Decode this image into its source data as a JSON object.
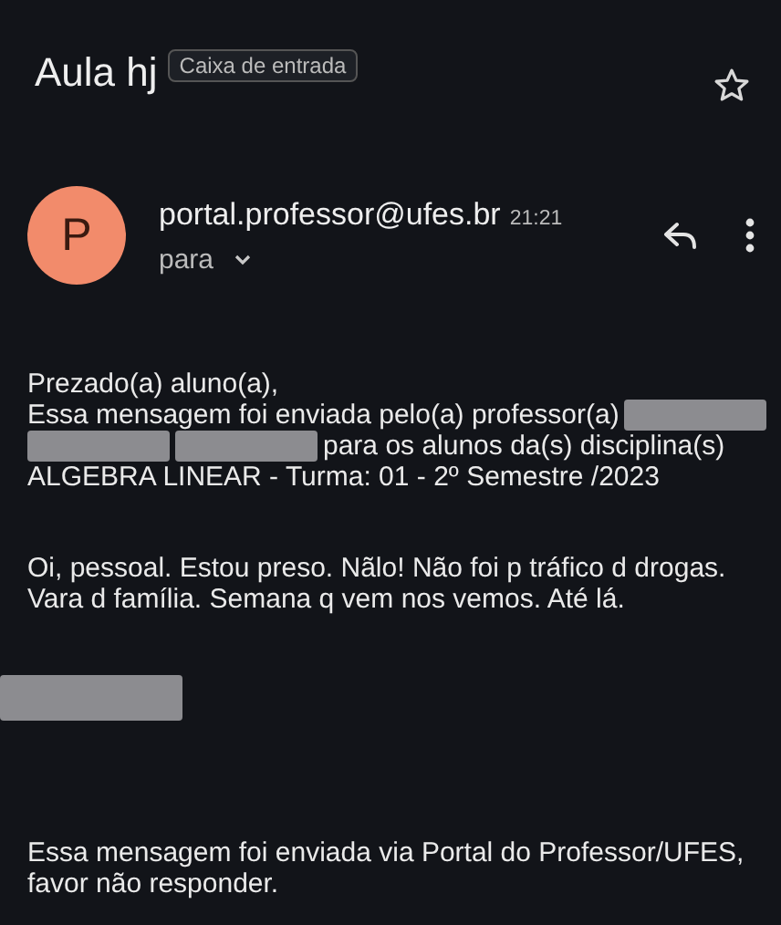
{
  "subject": {
    "title": "Aula hj",
    "label": "Caixa de entrada",
    "starred": false
  },
  "sender": {
    "avatar_letter": "P",
    "address": "portal.professor@ufes.br",
    "time": "21:21",
    "recipient_label": "para"
  },
  "body": [
    {
      "kind": "lines",
      "lines": [
        [
          {
            "kind": "text",
            "text": "Prezado(a) aluno(a),"
          }
        ],
        [
          {
            "kind": "text",
            "text": "Essa mensagem foi enviada pelo(a) professor(a)"
          },
          {
            "kind": "redacted"
          }
        ],
        [
          {
            "kind": "redacted"
          },
          {
            "kind": "redacted"
          },
          {
            "kind": "text",
            "text": "para os alunos da(s) disciplina(s)"
          }
        ],
        [
          {
            "kind": "text",
            "text": "ALGEBRA LINEAR - Turma: 01 - 2º Semestre /2023"
          }
        ]
      ]
    },
    {
      "kind": "paragraph",
      "text": "Oi, pessoal. Estou preso. Nãlo! Não foi p tráfico d drogas. Vara d família. Semana q vem nos vemos. Até lá."
    },
    {
      "kind": "redacted"
    },
    {
      "kind": "paragraph",
      "text": "Essa mensagem foi enviada via Portal do Professor/UFES, favor não responder."
    }
  ]
}
